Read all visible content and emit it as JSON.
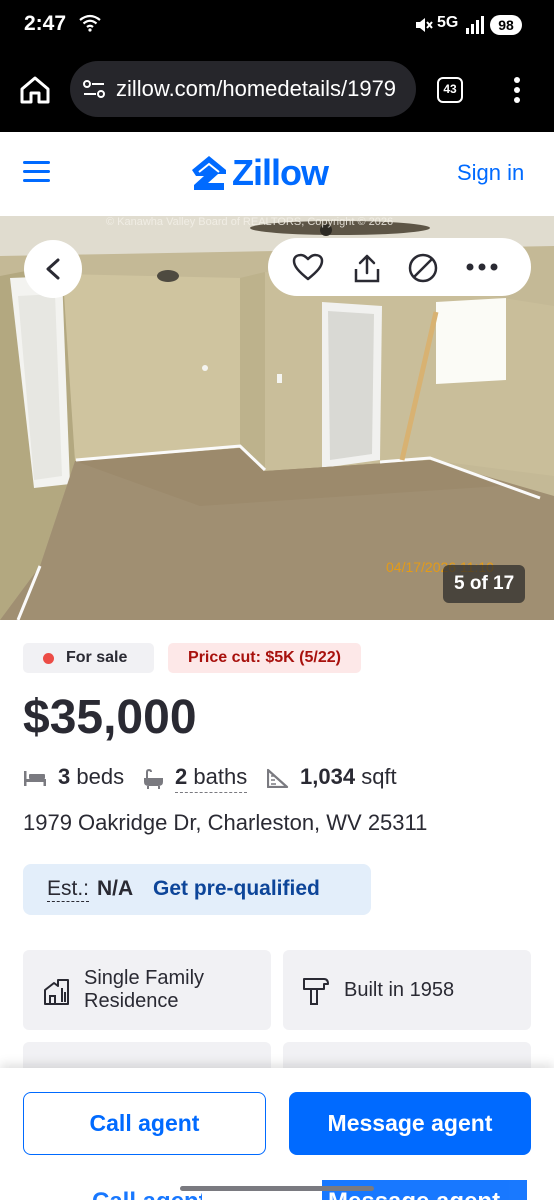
{
  "status": {
    "time": "2:47",
    "network": "5G",
    "battery": "98",
    "icons": [
      "wifi-icon",
      "mute-icon",
      "signal-icon"
    ]
  },
  "browser": {
    "url": "zillow.com/homedetails/1979",
    "tab_count": "43",
    "icons": [
      "home-icon",
      "tune-icon",
      "menu-dots-icon"
    ]
  },
  "header": {
    "logo": "Zillow",
    "sign_in": "Sign in"
  },
  "photo": {
    "watermark": "© Kanawha Valley Board of REALTORS, Copyright © 2026",
    "timestamp": "04/17/2026 11:10",
    "counter": "5 of 17",
    "actions": [
      "heart-icon",
      "share-icon",
      "hide-icon",
      "more-icon"
    ]
  },
  "listing": {
    "status_badge": "For sale",
    "price_cut_badge": "Price cut: $5K (5/22)",
    "price": "$35,000",
    "beds_value": "3",
    "beds_label": "beds",
    "baths_value": "2",
    "baths_label": "baths",
    "sqft_value": "1,034",
    "sqft_label": "sqft",
    "address": "1979 Oakridge Dr, Charleston, WV 25311",
    "est_label": "Est.:",
    "est_value": "N/A",
    "prequal": "Get pre-qualified"
  },
  "facts_cards": [
    {
      "label": "Single Family Residence",
      "line1": "Single Family",
      "line2": "Residence",
      "icon": "house-building-icon"
    },
    {
      "label": "Built in 1958",
      "icon": "hammer-icon"
    }
  ],
  "actions": {
    "call": "Call agent",
    "message": "Message agent"
  },
  "colors": {
    "brand": "#006aff",
    "price_cut_text": "#a8110d",
    "price_cut_bg": "#fde8e8",
    "sale_dot": "#ec4c46",
    "est_bg": "#e3eefa"
  }
}
